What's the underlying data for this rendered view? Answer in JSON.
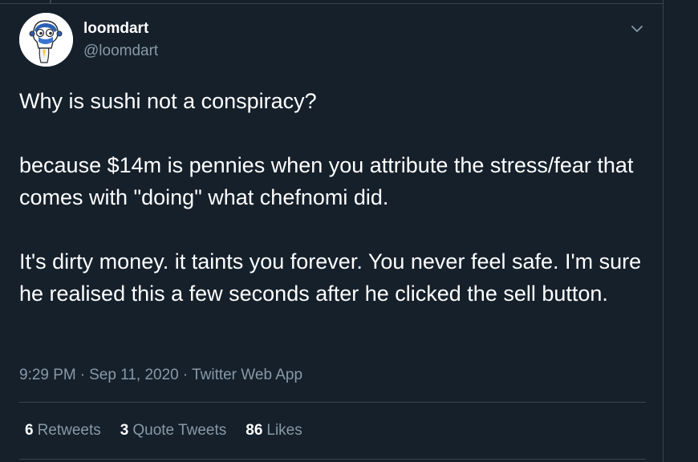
{
  "colors": {
    "background": "#15202b",
    "border": "#38444d",
    "primary_text": "#ffffff",
    "secondary_text": "#8899a6"
  },
  "author": {
    "display_name": "loomdart",
    "handle": "@loomdart",
    "avatar_icon": "cartoon-character-avatar"
  },
  "menu": {
    "icon": "chevron-down-icon"
  },
  "tweet": {
    "paragraphs": [
      "Why is sushi not a conspiracy?",
      "because $14m is pennies when you attribute the stress/fear that comes with \"doing\" what chefnomi did.",
      "It's dirty money. it taints you forever. You never feel safe. I'm sure he realised this a few seconds after he clicked the sell button."
    ],
    "time": "9:29 PM",
    "date": "Sep 11, 2020",
    "source": "Twitter Web App",
    "separator": "·"
  },
  "stats": {
    "retweets": {
      "count": "6",
      "label": "Retweets"
    },
    "quote_tweets": {
      "count": "3",
      "label": "Quote Tweets"
    },
    "likes": {
      "count": "86",
      "label": "Likes"
    }
  }
}
